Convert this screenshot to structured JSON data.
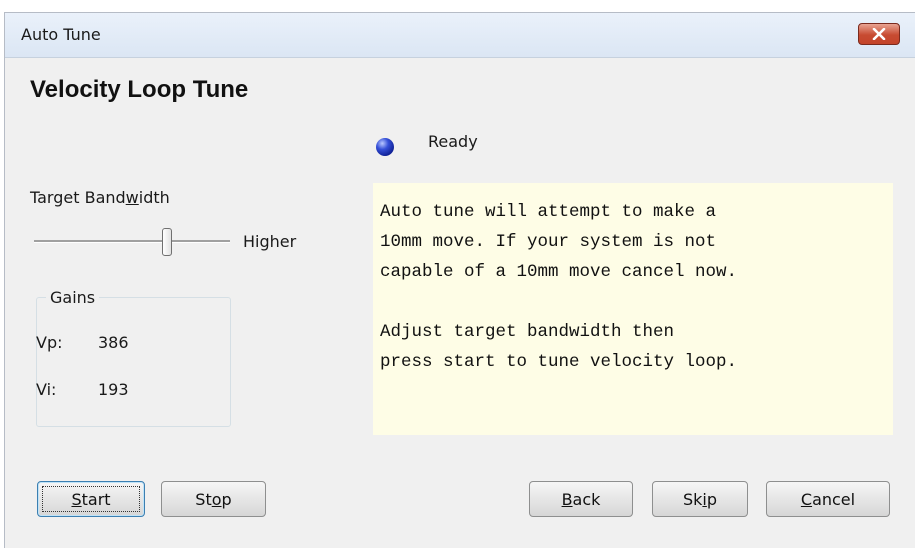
{
  "window": {
    "title": "Auto Tune"
  },
  "icons": {
    "close": "close-icon",
    "status": "status-led-icon"
  },
  "heading": "Velocity Loop Tune",
  "status": {
    "text": "Ready",
    "color": "#1a2db8"
  },
  "bandwidth": {
    "label_pre": "Target Band",
    "label_acc": "w",
    "label_post": "idth",
    "slider_value_fraction": 0.68,
    "higher_label": "Higher"
  },
  "gains": {
    "legend": "Gains",
    "rows": [
      {
        "label": "Vp:",
        "value": "386"
      },
      {
        "label": "Vi:",
        "value": "193"
      }
    ]
  },
  "info": {
    "text": "Auto tune will attempt to make a\n10mm move. If your system is not\ncapable of a 10mm move cancel now.\n\nAdjust target bandwidth then\npress start to tune velocity loop.",
    "background": "#fefde6"
  },
  "buttons": {
    "start": {
      "acc": "S",
      "rest": "tart"
    },
    "stop": {
      "pre": "St",
      "acc": "o",
      "post": "p"
    },
    "back": {
      "acc": "B",
      "rest": "ack"
    },
    "skip": {
      "pre": "Sk",
      "acc": "i",
      "post": "p"
    },
    "cancel": {
      "acc": "C",
      "rest": "ancel"
    }
  }
}
